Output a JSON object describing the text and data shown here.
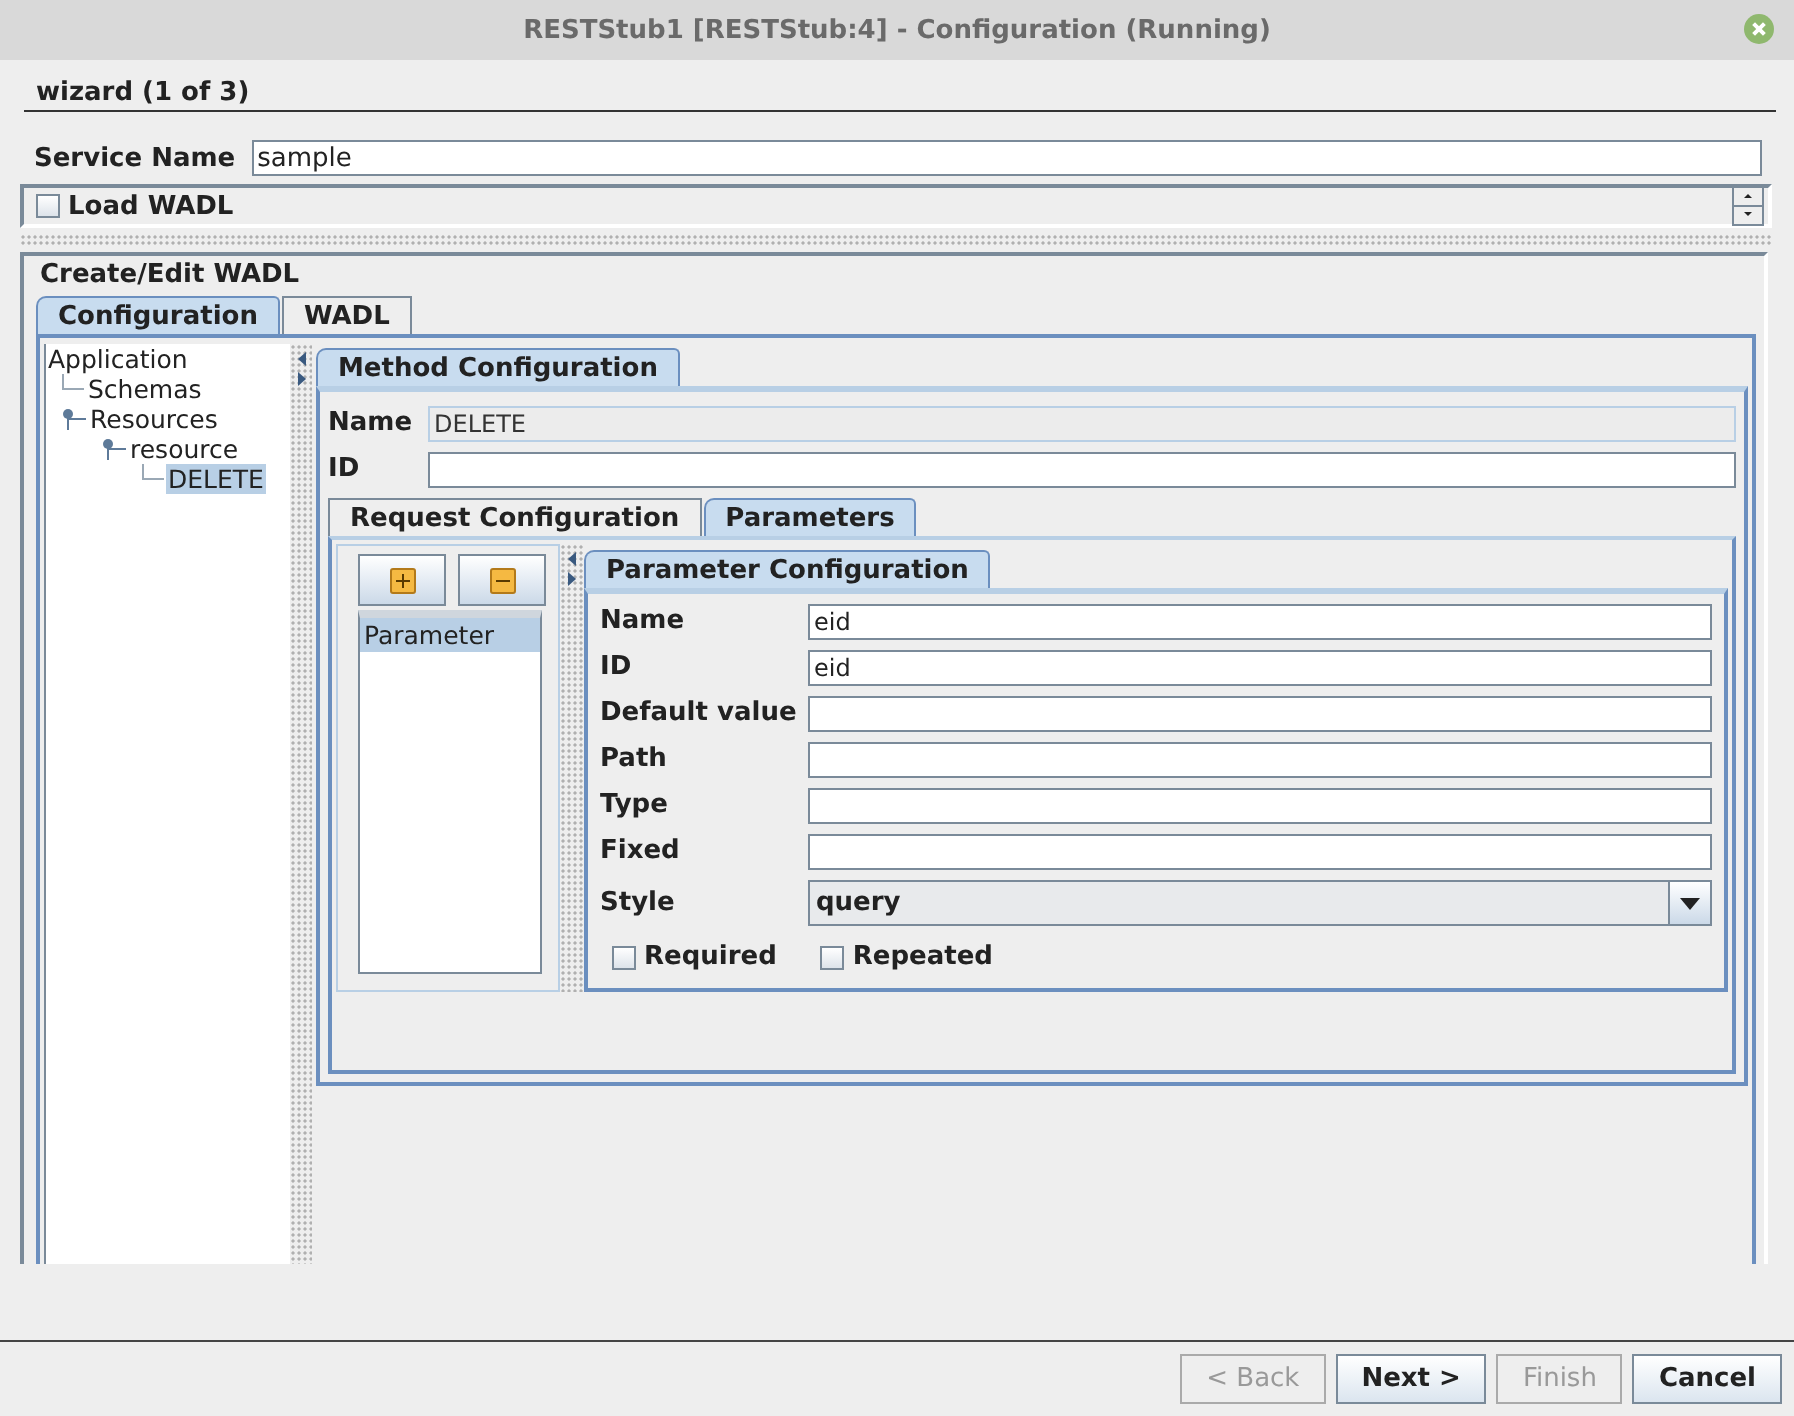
{
  "window": {
    "title": "RESTStub1 [RESTStub:4] - Configuration (Running)"
  },
  "wizard": {
    "heading": "wizard (1 of 3)"
  },
  "service_name": {
    "label": "Service Name",
    "value": "sample"
  },
  "load_wadl": {
    "label": "Load WADL",
    "checked": false
  },
  "group": {
    "title": "Create/Edit WADL"
  },
  "tabs": [
    {
      "label": "Configuration",
      "selected": true
    },
    {
      "label": "WADL",
      "selected": false
    }
  ],
  "tree": [
    {
      "label": "Application",
      "selected": false,
      "children": [
        {
          "label": "Schemas",
          "selected": false
        },
        {
          "label": "Resources",
          "selected": false,
          "children": [
            {
              "label": "resource",
              "selected": false,
              "children": [
                {
                  "label": "DELETE",
                  "selected": true
                }
              ]
            }
          ]
        }
      ]
    }
  ],
  "method": {
    "tab": "Method Configuration",
    "fields": [
      {
        "label": "Name",
        "value": "DELETE",
        "disabled": true
      },
      {
        "label": "ID",
        "disabled": false
      }
    ]
  },
  "sub_tabs": [
    {
      "label": "Request Configuration",
      "selected": false
    },
    {
      "label": "Parameters",
      "selected": true
    }
  ],
  "parameters": {
    "items": [
      {
        "label": "Parameter",
        "selected": true
      }
    ]
  },
  "param_config": {
    "tab": "Parameter Configuration",
    "fields": [
      {
        "label": "Name",
        "kind": "text",
        "value": "eid"
      },
      {
        "label": "ID",
        "kind": "text",
        "value": "eid"
      },
      {
        "label": "Default value",
        "kind": "text"
      },
      {
        "label": "Path",
        "kind": "text"
      },
      {
        "label": "Type",
        "kind": "text"
      },
      {
        "label": "Fixed",
        "kind": "text"
      },
      {
        "label": "Style",
        "kind": "select",
        "value": "query"
      }
    ],
    "options": [
      {
        "label": "Required",
        "checked": false
      },
      {
        "label": "Repeated",
        "checked": false
      }
    ]
  },
  "buttons": [
    {
      "label": "< Back",
      "disabled": true
    },
    {
      "label": "Next >",
      "disabled": false
    },
    {
      "label": "Finish",
      "disabled": true
    },
    {
      "label": "Cancel",
      "disabled": false
    }
  ]
}
